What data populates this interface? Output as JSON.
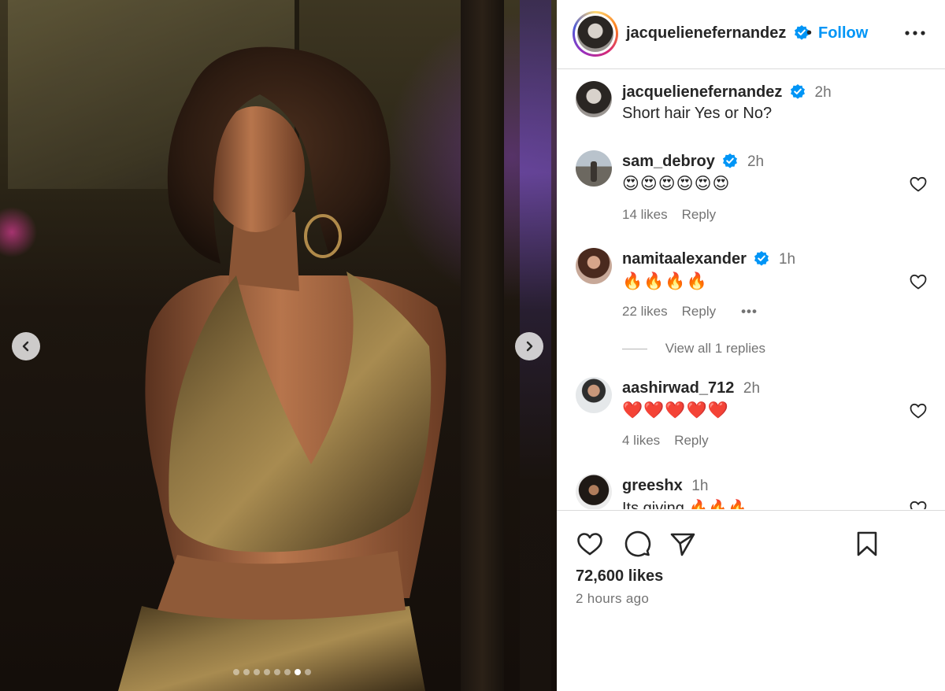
{
  "post": {
    "username": "jacquelienefernandez",
    "follow_label": "Follow",
    "separator": "•",
    "caption": "Short hair Yes or No?",
    "caption_time": "2h",
    "likes": "72,600 likes",
    "posted_ago": "2 hours ago",
    "carousel": {
      "total": 8,
      "active_index": 6
    }
  },
  "comments": [
    {
      "username": "sam_debroy",
      "verified": true,
      "time": "2h",
      "text": "😍😍😍😍😍😍",
      "likes": "14 likes",
      "reply": "Reply"
    },
    {
      "username": "namitaalexander",
      "verified": true,
      "time": "1h",
      "text": "🔥🔥🔥🔥",
      "likes": "22 likes",
      "reply": "Reply",
      "options": "•••",
      "view_replies": "View all 1 replies"
    },
    {
      "username": "aashirwad_712",
      "verified": false,
      "time": "2h",
      "text": "❤️❤️❤️❤️❤️",
      "likes": "4 likes",
      "reply": "Reply"
    },
    {
      "username": "greeshx",
      "verified": false,
      "time": "1h",
      "text": "Its giving 🔥🔥🔥"
    }
  ],
  "colors": {
    "link_blue": "#0095f6",
    "verified_blue": "#0095f6",
    "muted": "#737373",
    "text": "#262626",
    "border": "#dbdbdb"
  },
  "icons": [
    "chevron-left-icon",
    "chevron-right-icon",
    "more-icon",
    "verified-icon",
    "heart-icon",
    "comment-icon",
    "share-icon",
    "bookmark-icon"
  ]
}
